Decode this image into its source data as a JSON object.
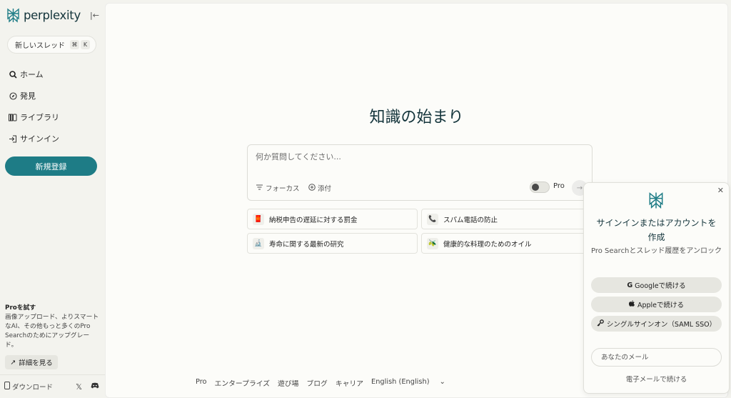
{
  "sidebar": {
    "logo_text": "perplexity",
    "new_thread": {
      "label": "新しいスレッド",
      "shortcut_cmd": "⌘",
      "shortcut_key": "K"
    },
    "nav": [
      {
        "label": "ホーム",
        "icon": "search-icon"
      },
      {
        "label": "発見",
        "icon": "compass-icon"
      },
      {
        "label": "ライブラリ",
        "icon": "library-icon"
      },
      {
        "label": "サインイン",
        "icon": "sign-in-icon"
      }
    ],
    "signup_label": "新規登録",
    "promo": {
      "title": "Proを試す",
      "body": "画像アップロード、よりスマートなAI、その他もっと多くのPro Searchのためにアップグレード。",
      "button_label": "詳細を見る"
    },
    "download_label": "ダウンロード"
  },
  "main": {
    "title": "知識の始まり",
    "ask": {
      "placeholder": "何か質問してください...",
      "focus_label": "フォーカス",
      "attach_label": "添付",
      "pro_label": "Pro"
    },
    "suggestions": [
      {
        "label": "納税申告の遅延に対する罰金",
        "emoji": "🧧"
      },
      {
        "label": "スパム電話の防止",
        "emoji": "📞"
      },
      {
        "label": "寿命に関する最新の研究",
        "emoji": "🔬"
      },
      {
        "label": "健康的な料理のためのオイル",
        "emoji": "🫒"
      }
    ],
    "footer": [
      "Pro",
      "エンタープライズ",
      "遊び場",
      "ブログ",
      "キャリア",
      "English (English)"
    ]
  },
  "popup": {
    "title": "サインインまたはアカウントを作成",
    "subtitle": "Pro Searchとスレッド履歴をアンロック",
    "google_label": "Googleで続ける",
    "apple_label": "Appleで続ける",
    "sso_label": "シングルサインオン（SAML SSO）",
    "email_placeholder": "あなたのメール",
    "email_continue": "電子メールで続ける"
  },
  "colors": {
    "accent": "#1e7c86",
    "text": "#13343b",
    "sidebar_bg": "#f3f3ee",
    "main_bg": "#fcfcf9"
  }
}
